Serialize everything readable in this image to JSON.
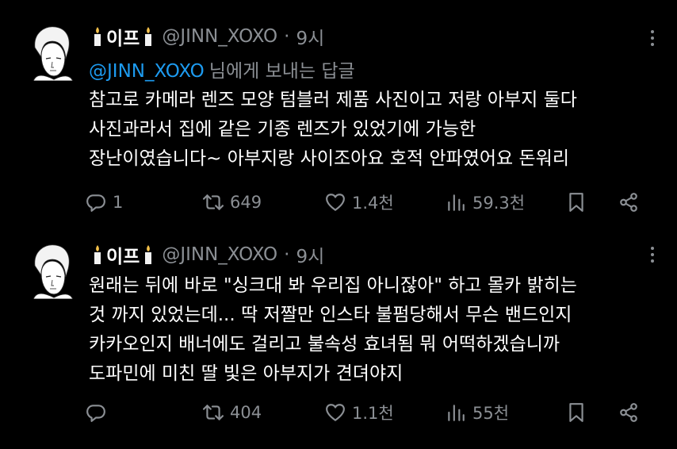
{
  "colors": {
    "background": "#000000",
    "text_primary": "#ffffff",
    "text_secondary": "#8b8f94",
    "mention": "#1d9bf0"
  },
  "tweets": [
    {
      "display_name": "이프",
      "handle": "@JINN_XOXO",
      "separator": "·",
      "time": "9시",
      "reply_to": {
        "mention": "@JINN_XOXO",
        "text": "님에게 보내는 답글"
      },
      "body_lines": [
        "참고로 카메라 렌즈 모양 텀블러 제품 사진이고 저랑 아부지 둘다",
        "사진과라서  집에 같은 기종 렌즈가 있었기에 가능한",
        "장난이였습니다~ 아부지랑 사이조아요 호적 안파였어요 돈워리"
      ],
      "stats": {
        "replies": "1",
        "retweets": "649",
        "likes": "1.4천",
        "views": "59.3천"
      },
      "icons": [
        "candle-icon",
        "reply-icon",
        "retweet-icon",
        "like-icon",
        "views-icon",
        "bookmark-icon",
        "share-icon",
        "more-icon"
      ]
    },
    {
      "display_name": "이프",
      "handle": "@JINN_XOXO",
      "separator": "·",
      "time": "9시",
      "body_lines": [
        "원래는 뒤에 바로 \"싱크대 봐 우리집 아니잖아\" 하고 몰카 밝히는",
        "것 까지 있었는데... 딱 저짤만 인스타 불펌당해서 무슨 밴드인지",
        "카카오인지 배너에도 걸리고 불속성 효녀됨 뭐 어떡하겠습니까",
        "도파민에 미친 딸 빛은 아부지가 견뎌야지"
      ],
      "stats": {
        "replies": "",
        "retweets": "404",
        "likes": "1.1천",
        "views": "55천"
      },
      "icons": [
        "candle-icon",
        "reply-icon",
        "retweet-icon",
        "like-icon",
        "views-icon",
        "bookmark-icon",
        "share-icon",
        "more-icon"
      ]
    }
  ]
}
